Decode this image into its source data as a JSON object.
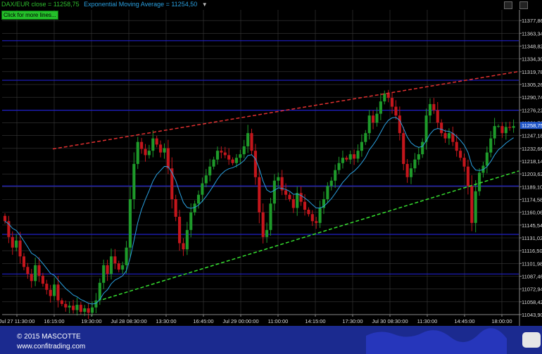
{
  "header": {
    "symbol_text": "DAX/EUR close = 11258,75",
    "ema_text": "Exponential Moving Average = 11254,50",
    "dropdown_glyph": "▼",
    "more_lines_label": "Click for more lines..."
  },
  "footer": {
    "copyright": "© 2015 MASCOTTE",
    "website": "www.confitrading.com"
  },
  "colors": {
    "up": "#1e9a2a",
    "down": "#c4161c",
    "ema": "#2aa0e0",
    "resistance": "#e03030",
    "support": "#36e030",
    "hlines": "#2020c8",
    "grid": "#3a3a3a",
    "last_price_bg": "#1f55c8"
  },
  "chart_data": {
    "type": "candlestick",
    "ylim": [
      11043.9,
      11390.0
    ],
    "y_ticks": [
      "11377,86",
      "11363,34",
      "11348,82",
      "11334,30",
      "11319,78",
      "11305,26",
      "11290,74",
      "11276,22",
      "11261,70",
      "11247,18",
      "11232,66",
      "11218,14",
      "11203,62",
      "11189,10",
      "11174,58",
      "11160,06",
      "11145,54",
      "11131,02",
      "11116,50",
      "11101,98",
      "11087,46",
      "11072,94",
      "11058,42",
      "11043,90"
    ],
    "x_labels": [
      "Jul 27 11:30:00",
      "16:15:00",
      "19:30:00",
      "Jul 28 08:30:00",
      "13:30:00",
      "16:45:00",
      "Jul 29 00:00:00",
      "11:00:00",
      "14:15:00",
      "17:30:00",
      "Jul 30 08:30:00",
      "11:30:00",
      "14:45:00",
      "18:00:00"
    ],
    "last_price": "11258,75",
    "last_price_value": 11258.75,
    "horizontal_levels": [
      11355,
      11310,
      11276,
      11190,
      11135,
      11090
    ],
    "trendlines": [
      {
        "name": "resistance",
        "from": [
          "Jul 27 19:30:00",
          11232
        ],
        "to": [
          "Jul 30 18:00:00",
          11320
        ]
      },
      {
        "name": "support",
        "from": [
          "Jul 28 03:00:00",
          11061
        ],
        "to": [
          "Jul 30 18:00:00",
          11207
        ]
      }
    ],
    "series": [
      {
        "name": "DAX/EUR close",
        "closes": [
          11150,
          11132,
          11120,
          11128,
          11110,
          11098,
          11090,
          11082,
          11100,
          11088,
          11079,
          11072,
          11065,
          11078,
          11060,
          11056,
          11052,
          11054,
          11049,
          11055,
          11047,
          11051,
          11046,
          11052,
          11060,
          11080,
          11100,
          11090,
          11110,
          11102,
          11095,
          11100,
          11120,
          11175,
          11215,
          11240,
          11232,
          11225,
          11230,
          11244,
          11237,
          11228,
          11233,
          11210,
          11175,
          11155,
          11125,
          11118,
          11140,
          11160,
          11170,
          11180,
          11193,
          11202,
          11212,
          11220,
          11230,
          11228,
          11225,
          11220,
          11216,
          11222,
          11226,
          11235,
          11250,
          11230,
          11200,
          11160,
          11132,
          11140,
          11170,
          11196,
          11200,
          11185,
          11180,
          11175,
          11165,
          11182,
          11172,
          11163,
          11158,
          11150,
          11148,
          11165,
          11175,
          11190,
          11196,
          11208,
          11216,
          11222,
          11220,
          11226,
          11221,
          11230,
          11240,
          11250,
          11270,
          11262,
          11272,
          11286,
          11295,
          11290,
          11280,
          11270,
          11250,
          11215,
          11200,
          11210,
          11220,
          11226,
          11240,
          11270,
          11283,
          11276,
          11262,
          11250,
          11244,
          11250,
          11240,
          11230,
          11222,
          11212,
          11190,
          11148,
          11184,
          11205,
          11213,
          11228,
          11244,
          11258,
          11258,
          11250,
          11257,
          11256,
          11258
        ]
      },
      {
        "name": "Exponential Moving Average",
        "values": "computed from closes"
      }
    ]
  }
}
